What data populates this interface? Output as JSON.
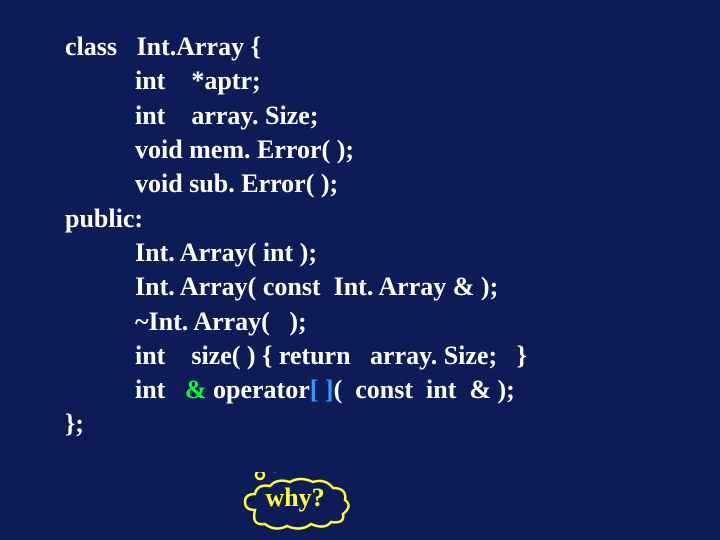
{
  "code": {
    "l1": "class   Int.Array {",
    "l2": "int    *aptr;",
    "l3": "int    array. Size;",
    "l4": "void mem. Error( );",
    "l5": "void sub. Error( );",
    "l6": "public:",
    "l7": "Int. Array( int );",
    "l8": "Int. Array( const  Int. Array & );",
    "l9": "~Int. Array(   );",
    "l10": "int    size( ) { return   array. Size;   }",
    "l11a": "int   ",
    "l11_amp": "&",
    "l11b": " operator",
    "l11_brackets": "[ ]",
    "l11c": "(  const  int  & );",
    "l12": "};"
  },
  "callout": {
    "label": "why?"
  },
  "colors": {
    "bg": "#0d1b56",
    "text": "#ffffff",
    "amp": "#00ff33",
    "brackets": "#3399ff",
    "why": "#ffff33"
  }
}
